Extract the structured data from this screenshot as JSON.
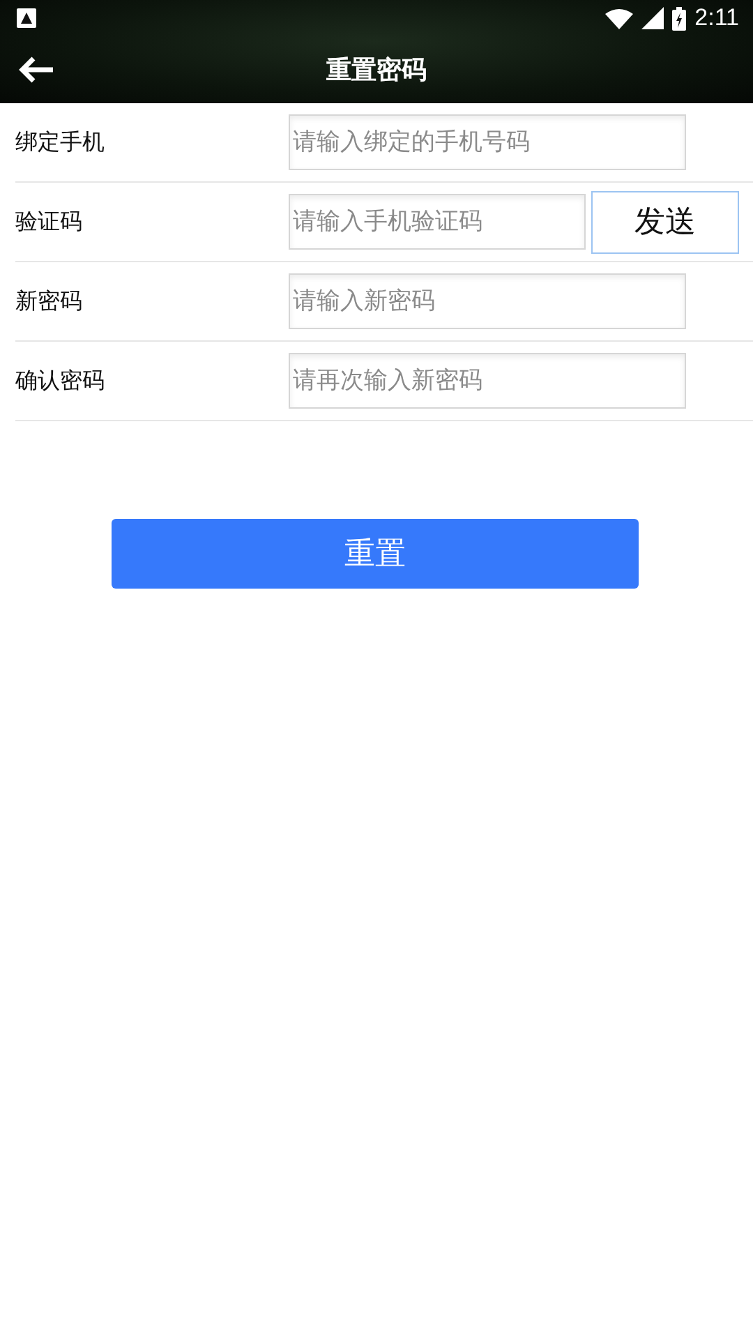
{
  "status_bar": {
    "time": "2:11"
  },
  "header": {
    "title": "重置密码"
  },
  "form": {
    "rows": [
      {
        "kind": "field",
        "label": "绑定手机",
        "placeholder": "请输入绑定的手机号码"
      },
      {
        "kind": "field-with-button",
        "label": "验证码",
        "placeholder": "请输入手机验证码",
        "button": "发送"
      },
      {
        "kind": "field",
        "label": "新密码",
        "placeholder": "请输入新密码"
      },
      {
        "kind": "field",
        "label": "确认密码",
        "placeholder": "请再次输入新密码"
      }
    ]
  },
  "submit": {
    "label": "重置"
  }
}
